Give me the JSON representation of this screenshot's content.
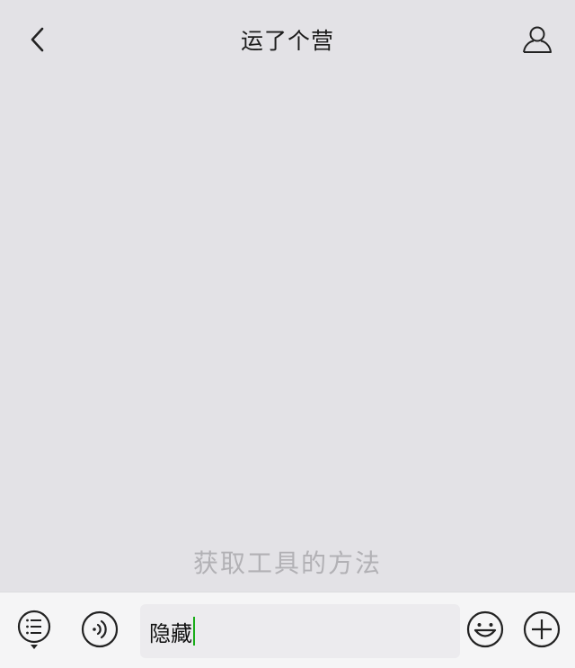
{
  "header": {
    "title": "运了个营",
    "back_icon": "chevron-left-icon",
    "profile_icon": "user-icon"
  },
  "chat": {
    "hint_text": "获取工具的方法"
  },
  "input_bar": {
    "menu_icon": "list-menu-icon",
    "voice_icon": "voice-icon",
    "input_value": "隐藏",
    "emoji_icon": "emoji-icon",
    "plus_icon": "plus-icon"
  },
  "colors": {
    "background": "#e3e2e6",
    "input_bar": "#f5f5f6",
    "caret": "#1aad19",
    "hint_text": "#b2b1b5"
  }
}
